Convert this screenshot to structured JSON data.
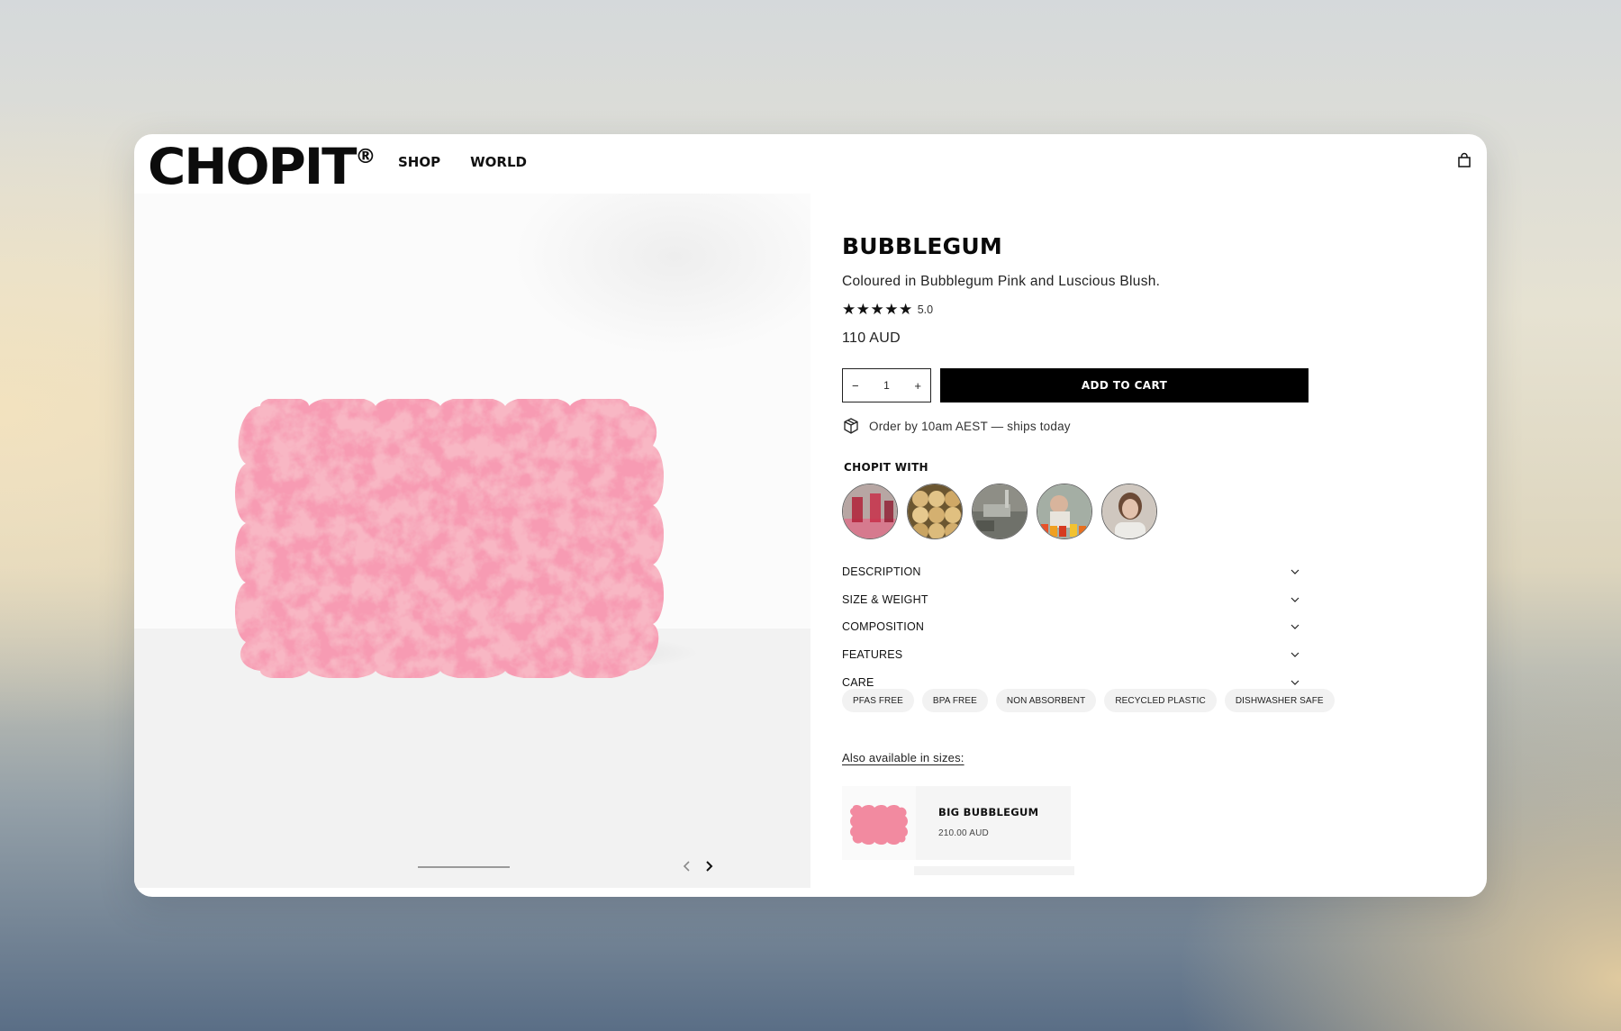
{
  "header": {
    "logo_text": "CHOPIT",
    "logo_mark": "®",
    "nav": [
      "SHOP",
      "WORLD"
    ],
    "cart_icon": "shopping-bag-icon"
  },
  "product": {
    "title": "BUBBLEGUM",
    "subtitle": "Coloured in Bubblegum Pink and Luscious Blush.",
    "stars": "★★★★★",
    "rating": "5.0",
    "price": "110 AUD",
    "quantity": "1",
    "qty_minus": "−",
    "qty_plus": "+",
    "add_to_cart": "ADD TO CART",
    "shipping_note": "Order by 10am AEST — ships today",
    "shipping_icon": "package-box-icon",
    "image_color": "#f08aa0"
  },
  "chopit_with": {
    "heading": "CHOPIT WITH",
    "thumbnails": [
      "drinks-photo",
      "pastries-photo",
      "kitchen-sink-photo",
      "person-juices-photo",
      "person-portrait-photo"
    ]
  },
  "accordion": [
    "DESCRIPTION",
    "SIZE & WEIGHT",
    "COMPOSITION",
    "FEATURES",
    "CARE"
  ],
  "tags": [
    "PFAS FREE",
    "BPA FREE",
    "NON ABSORBENT",
    "RECYCLED PLASTIC",
    "DISHWASHER SAFE"
  ],
  "sizes": {
    "heading": "Also available in sizes:",
    "items": [
      {
        "name": "BIG BUBBLEGUM",
        "price": "210.00 AUD"
      }
    ]
  },
  "gallery": {
    "prev_icon": "chevron-left-icon",
    "next_icon": "chevron-right-icon"
  }
}
